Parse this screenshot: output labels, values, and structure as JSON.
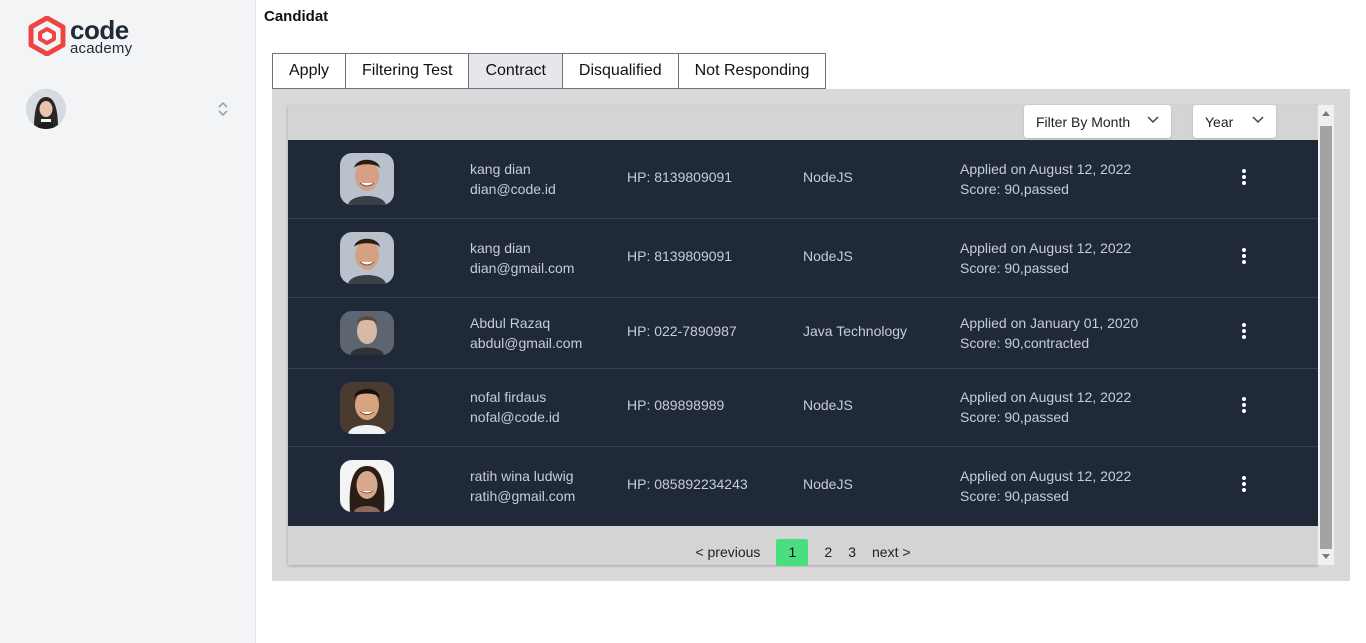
{
  "brand": {
    "line1": "code",
    "line2": "academy",
    "color": "#ef4444"
  },
  "page": {
    "title": "Candidat"
  },
  "tabs": [
    {
      "label": "Apply",
      "active": false
    },
    {
      "label": "Filtering Test",
      "active": false
    },
    {
      "label": "Contract",
      "active": true
    },
    {
      "label": "Disqualified",
      "active": false
    },
    {
      "label": "Not Responding",
      "active": false
    }
  ],
  "filters": {
    "month_label": "Filter By Month",
    "year_label": "Year"
  },
  "candidates": [
    {
      "name": "kang dian",
      "email": "dian@code.id",
      "phone": "HP: 8139809091",
      "tech": "NodeJS",
      "applied": "Applied on August 12, 2022",
      "score": "Score: 90,passed"
    },
    {
      "name": "kang dian",
      "email": "dian@gmail.com",
      "phone": "HP: 8139809091",
      "tech": "NodeJS",
      "applied": "Applied on August 12, 2022",
      "score": "Score: 90,passed"
    },
    {
      "name": "Abdul Razaq",
      "email": "abdul@gmail.com",
      "phone": "HP: 022-7890987",
      "tech": "Java Technology",
      "applied": "Applied on January 01, 2020",
      "score": "Score: 90,contracted"
    },
    {
      "name": "nofal firdaus",
      "email": "nofal@code.id",
      "phone": "HP: 089898989",
      "tech": "NodeJS",
      "applied": "Applied on August 12, 2022",
      "score": "Score: 90,passed"
    },
    {
      "name": "ratih wina ludwig",
      "email": "ratih@gmail.com",
      "phone": "HP: 085892234243",
      "tech": "NodeJS",
      "applied": "Applied on August 12, 2022",
      "score": "Score: 90,passed"
    }
  ],
  "pagination": {
    "previous": "< previous",
    "pages": [
      "1",
      "2",
      "3"
    ],
    "current": "1",
    "next": "next >"
  },
  "colors": {
    "table_bg": "#1f2937",
    "active_page": "#4ade80",
    "panel_bg": "#d9d9d9"
  }
}
